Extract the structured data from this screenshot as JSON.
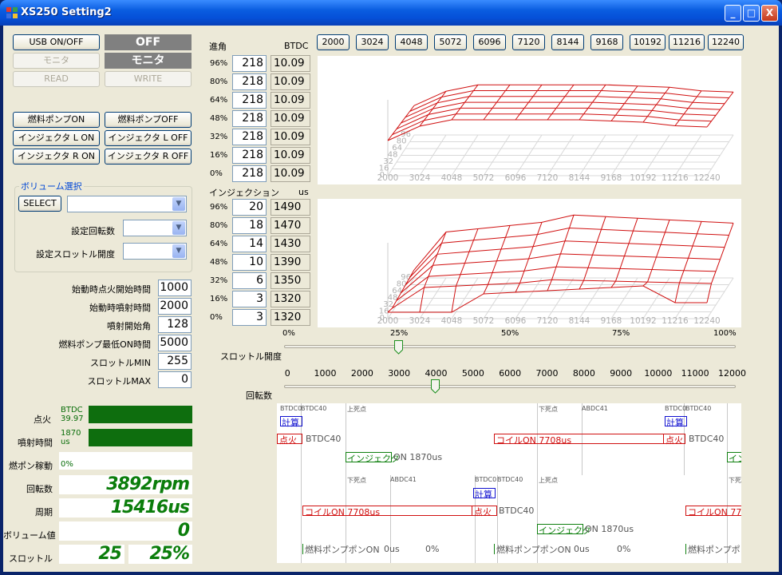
{
  "window": {
    "title": "XS250 Setting2",
    "minimize": "_",
    "maximize": "□",
    "close": "X"
  },
  "buttons": {
    "usb": "USB ON/OFF",
    "monitor": "モニタ",
    "read": "READ",
    "write": "WRITE",
    "fuel_on": "燃料ポンプON",
    "fuel_off": "燃料ポンプOFF",
    "inj_l_on": "インジェクタ L ON",
    "inj_l_off": "インジェクタ L OFF",
    "inj_r_on": "インジェクタ R ON",
    "inj_r_off": "インジェクタ R OFF",
    "select": "SELECT"
  },
  "status": {
    "usb_state": "OFF",
    "monitor_state": "モニタ"
  },
  "volume_group": {
    "title": "ボリューム選択",
    "rpm_label": "設定回転数",
    "throttle_label": "設定スロットル開度"
  },
  "params": [
    {
      "label": "始動時点火開始時間",
      "value": "1000"
    },
    {
      "label": "始動時噴射時間",
      "value": "2000"
    },
    {
      "label": "噴射開始角",
      "value": "128"
    },
    {
      "label": "燃料ポンプ最低ON時間",
      "value": "5000"
    },
    {
      "label": "スロットルMIN",
      "value": "255"
    },
    {
      "label": "スロットルMAX",
      "value": "0"
    }
  ],
  "monitor": {
    "ignition_label": "点火",
    "ignition_value": "BTDC\n39.97",
    "injection_label": "噴射時間",
    "injection_value": "1870\nus",
    "pump_label": "燃ポン稼動",
    "pump_value": "0%",
    "rpm_label": "回転数",
    "rpm_value": "3892rpm",
    "period_label": "周期",
    "period_value": "15416us",
    "volume_label": "ボリューム値",
    "volume_value": "0",
    "throttle_label": "スロットル",
    "throttle_value": "25",
    "throttle_pct": "25%"
  },
  "advance": {
    "label": "進角",
    "unit": "BTDC",
    "rows": [
      {
        "pct": "96%",
        "val": "218",
        "btdc": "10.09"
      },
      {
        "pct": "80%",
        "val": "218",
        "btdc": "10.09"
      },
      {
        "pct": "64%",
        "val": "218",
        "btdc": "10.09"
      },
      {
        "pct": "48%",
        "val": "218",
        "btdc": "10.09"
      },
      {
        "pct": "32%",
        "val": "218",
        "btdc": "10.09"
      },
      {
        "pct": "16%",
        "val": "218",
        "btdc": "10.09"
      },
      {
        "pct": "0%",
        "val": "218",
        "btdc": "10.09"
      }
    ]
  },
  "injection": {
    "label": "インジェクション",
    "unit": "us",
    "rows": [
      {
        "pct": "96%",
        "val": "20",
        "us": "1490"
      },
      {
        "pct": "80%",
        "val": "18",
        "us": "1470"
      },
      {
        "pct": "64%",
        "val": "14",
        "us": "1430"
      },
      {
        "pct": "48%",
        "val": "10",
        "us": "1390"
      },
      {
        "pct": "32%",
        "val": "6",
        "us": "1350"
      },
      {
        "pct": "16%",
        "val": "3",
        "us": "1320"
      },
      {
        "pct": "0%",
        "val": "3",
        "us": "1320"
      }
    ]
  },
  "rpm_buttons": [
    "2000",
    "3024",
    "4048",
    "5072",
    "6096",
    "7120",
    "8144",
    "9168",
    "10192",
    "11216",
    "12240"
  ],
  "throttle_slider": {
    "label": "スロットル開度",
    "ticks": [
      "0%",
      "25%",
      "50%",
      "75%",
      "100%"
    ],
    "value_pct": 25
  },
  "rpm_slider": {
    "label": "回転数",
    "ticks": [
      "0",
      "1000",
      "2000",
      "3000",
      "4000",
      "5000",
      "6000",
      "7000",
      "8000",
      "9000",
      "10000",
      "11000",
      "12000"
    ],
    "value": 4000
  },
  "chart_data": [
    {
      "type": "surface",
      "title": "",
      "x_categories": [
        "2000",
        "3024",
        "4048",
        "5072",
        "6096",
        "7120",
        "8144",
        "9168",
        "10192",
        "11216",
        "12240"
      ],
      "y_ticks": [
        "0",
        "16",
        "32",
        "48",
        "64",
        "80",
        "96"
      ],
      "color": "#d01010"
    },
    {
      "type": "surface",
      "title": "",
      "x_categories": [
        "2000",
        "3024",
        "4048",
        "5072",
        "6096",
        "7120",
        "8144",
        "9168",
        "10192",
        "11216",
        "12240"
      ],
      "y_ticks": [
        "0",
        "16",
        "32",
        "48",
        "64",
        "80",
        "96"
      ],
      "color": "#d01010"
    }
  ],
  "timing": {
    "top_labels": [
      "BTDC0",
      "BTDC40",
      "上死点",
      "下死点",
      "ABDC41",
      "BTDC0",
      "BTDC40"
    ],
    "calc": "計算",
    "ignite": "点火",
    "btdc40": "BTDC40",
    "coil": "コイルON  7708us",
    "injector": "インジェクタ",
    "inj_on": "ON 1870us",
    "mid_labels": [
      "下死点",
      "ABDC41",
      "BTDC0",
      "BTDC40",
      "上死点",
      "下死点"
    ],
    "pump": "燃料ポンプポンON",
    "pump_us": "0us",
    "pump_pct": "0%"
  }
}
